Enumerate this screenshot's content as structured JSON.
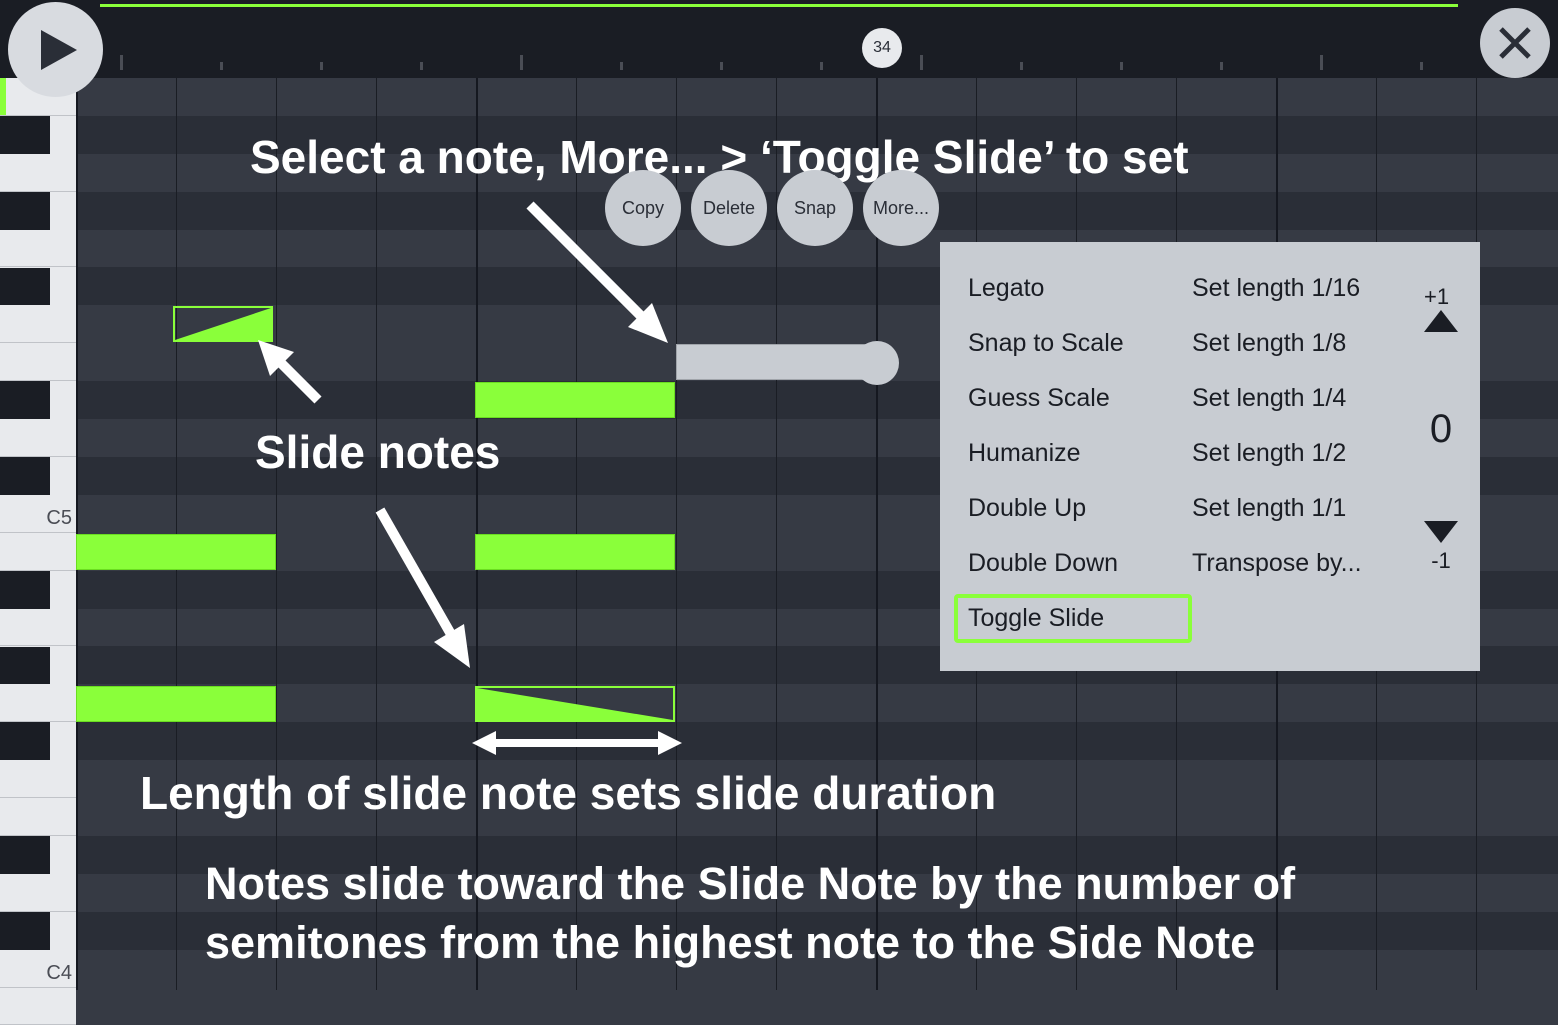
{
  "playhead": {
    "position": "34"
  },
  "piano": {
    "labels": {
      "c5": "C5",
      "c4": "C4"
    }
  },
  "actions": {
    "copy": "Copy",
    "delete": "Delete",
    "snap": "Snap",
    "more": "More..."
  },
  "menu": {
    "col1": [
      "Legato",
      "Snap to Scale",
      "Guess Scale",
      "Humanize",
      "Double Up",
      "Double Down",
      "Toggle Slide"
    ],
    "col2": [
      "Set length 1/16",
      "Set length 1/8",
      "Set length 1/4",
      "Set length 1/2",
      "Set length 1/1",
      "Transpose by..."
    ],
    "stepper": {
      "plus": "+1",
      "value": "0",
      "minus": "-1"
    }
  },
  "annotations": {
    "top": "Select a note, More... > ‘Toggle Slide’ to set",
    "mid": "Slide notes",
    "len": "Length of slide note sets slide duration",
    "bottom": "Notes slide toward the Slide Note by the number of semitones from the highest note to the Side Note"
  }
}
